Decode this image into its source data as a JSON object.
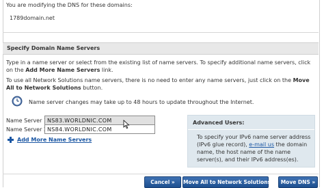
{
  "header": {
    "intro_text": "You are modifying the DNS for these domains:",
    "domain": "1789domain.net"
  },
  "section": {
    "title": "Specify Domain Name Servers",
    "para1_a": "Type in a name server or select from the existing list of name servers. To specify additional name servers, click on the ",
    "para1_bold": "Add More Name Servers",
    "para1_b": " link.",
    "para2_a": "To use all Network Solutions name servers, there is no need to enter any name servers, just click on the ",
    "para2_bold": "Move All to Network Solutions",
    "para2_b": " button.",
    "update_note": "Name server changes may take up to 48 hours to update throughout the Internet."
  },
  "name_servers": [
    {
      "label": "Name Server 1:",
      "value": "NS83.WORLDNIC.COM"
    },
    {
      "label": "Name Server 2:",
      "value": "NS84.WORLDNIC.COM"
    }
  ],
  "add_more_label": "Add More Name Servers",
  "advanced": {
    "title": "Advanced Users:",
    "text_a": "To specify your IPv6 name server address (IPv6 glue record), ",
    "link": "e-mail us",
    "text_b": " the domain name, the host name of the name server(s), and their IPv6 address(es)."
  },
  "buttons": {
    "cancel": "Cancel »",
    "move_all": "Move All to Network Solutions »",
    "move_dns": "Move DNS »"
  },
  "colors": {
    "link": "#1a56a3",
    "button": "#2a5d9f",
    "advanced_bg": "#dfe8ee"
  }
}
